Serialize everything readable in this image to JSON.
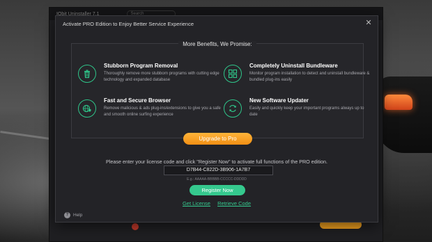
{
  "background_app": {
    "title": "IObit Uninstaller 7.1",
    "search_placeholder": "Search"
  },
  "modal": {
    "title": "Activate PRO Edition to Enjoy Better Service Experience",
    "close_label": "✕",
    "benefits_heading": "More Benefits, We Promise:",
    "features": [
      {
        "title": "Stubborn Program Removal",
        "description": "Thoroughly remove more stubborn programs with cutting edge technology and expanded database",
        "icon": "trash-icon"
      },
      {
        "title": "Completely Uninstall Bundleware",
        "description": "Monitor program installation to detect and uninstall bundleware & bundled plug-ins easily",
        "icon": "bundle-icon"
      },
      {
        "title": "Fast and Secure Browser",
        "description": "Remove malicious & ads plug-ins/extensions to give you a safe and smooth online surfing experience",
        "icon": "globe-shield-icon"
      },
      {
        "title": "New Software Updater",
        "description": "Easily and quickly keep your important programs always up to date",
        "icon": "refresh-icon"
      }
    ],
    "upgrade_label": "Upgrade to Pro",
    "license_prompt": "Please enter your license code and click \"Register Now\" to activate full functions of the PRO edition.",
    "license_value": "D7B44-C822D-3B906-1A7B7",
    "license_example": "E.g.: AAAAA-BBBBB-CCCCC-DDDDD",
    "register_label": "Register Now",
    "get_license_label": "Get License",
    "retrieve_code_label": "Retrieve Code",
    "help_label": "Help",
    "accent_color": "#35c98e",
    "upgrade_color": "#f5a020"
  }
}
